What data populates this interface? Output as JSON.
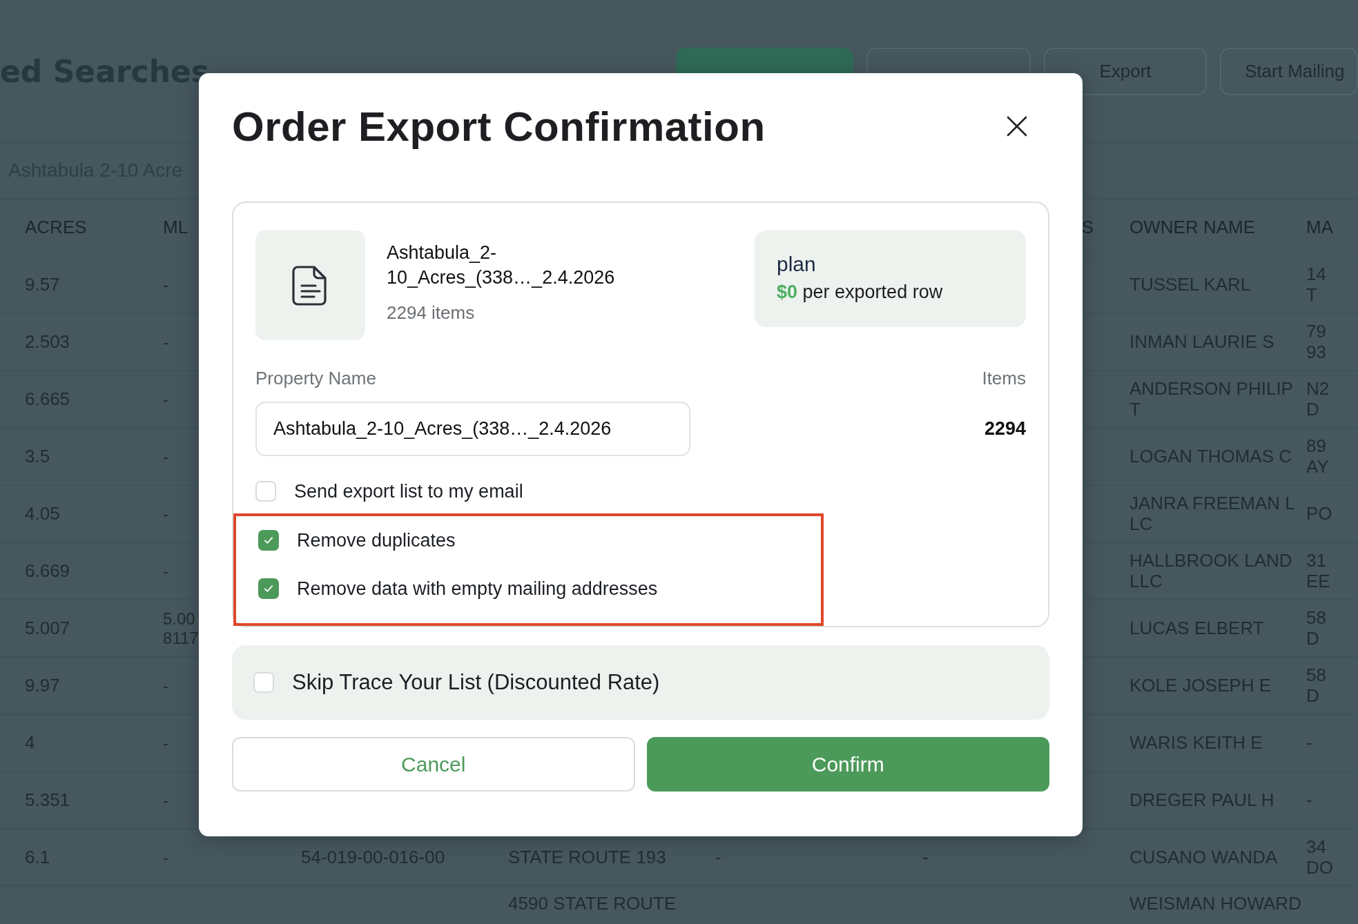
{
  "page": {
    "title": "ed Searches",
    "actions": [
      {
        "kind": "primary"
      },
      {
        "kind": "outline"
      },
      {
        "label": "Export",
        "kind": "outline"
      },
      {
        "label": "Start Mailing",
        "kind": "outline"
      }
    ],
    "tab": "Ashtabula 2-10 Acre"
  },
  "table": {
    "columns": {
      "acres": "ACRES",
      "mls": "ML",
      "column_6": "S",
      "owner_name": "OWNER NAME",
      "column_8": "MA"
    },
    "rows": [
      {
        "acres": "9.57",
        "mls": "-",
        "owner_name": "TUSSEL KARL",
        "column_8": "14 T"
      },
      {
        "acres": "2.503",
        "mls": "-",
        "owner_name": "INMAN LAURIE S",
        "column_8": "79 93"
      },
      {
        "acres": "6.665",
        "mls": "-",
        "owner_name": "ANDERSON PHILIP T",
        "column_8": "N2 D"
      },
      {
        "acres": "3.5",
        "mls": "-",
        "owner_name": "LOGAN THOMAS C",
        "column_8": "89 AY"
      },
      {
        "acres": "4.05",
        "mls": "-",
        "owner_name": "JANRA FREEMAN L LC",
        "column_8": "PO"
      },
      {
        "acres": "6.669",
        "mls": "-",
        "owner_name": "HALLBROOK LAND LLC",
        "column_8": "31 EE"
      },
      {
        "acres": "5.007",
        "mls": "5.00 8117",
        "owner_name": "LUCAS ELBERT",
        "column_8": "58 D"
      },
      {
        "acres": "9.97",
        "mls": "-",
        "owner_name": "KOLE JOSEPH E",
        "column_8": "58 D"
      },
      {
        "acres": "4",
        "mls": "-",
        "owner_name": "WARIS KEITH E",
        "column_8": "-"
      },
      {
        "acres": "5.351",
        "mls": "-",
        "owner_name": "DREGER PAUL H",
        "column_8": "-"
      },
      {
        "acres": "6.1",
        "mls": "-",
        "column_3": "54-019-00-016-00",
        "column_4": "STATE ROUTE 193",
        "column_5": "-",
        "column_6": "-",
        "owner_name": "CUSANO WANDA",
        "column_8": "34 DO"
      },
      {
        "column_4": "4590 STATE ROUTE",
        "owner_name": "WEISMAN HOWARD"
      }
    ]
  },
  "modal": {
    "title": "Order Export Confirmation",
    "file": {
      "name": "Ashtabula_2-10_Acres_(338…_2.4.2026",
      "count": "2294 items"
    },
    "plan": {
      "name": "plan",
      "price": "$0",
      "unit": "per exported row"
    },
    "property_label": "Property Name",
    "property_value": "Ashtabula_2-10_Acres_(338…_2.4.2026",
    "items_label": "Items",
    "items_value": "2294",
    "options": [
      {
        "label": "Send export list to my email",
        "checked": false,
        "highlighted": false
      },
      {
        "label": "Remove duplicates",
        "checked": true,
        "highlighted": true
      },
      {
        "label": "Remove data with empty mailing addresses",
        "checked": true,
        "highlighted": true
      }
    ],
    "skip_trace": {
      "label": "Skip Trace Your List (Discounted Rate)",
      "checked": false
    },
    "buttons": [
      {
        "label": "Cancel",
        "kind": "secondary"
      },
      {
        "label": "Confirm",
        "kind": "primary"
      }
    ]
  }
}
